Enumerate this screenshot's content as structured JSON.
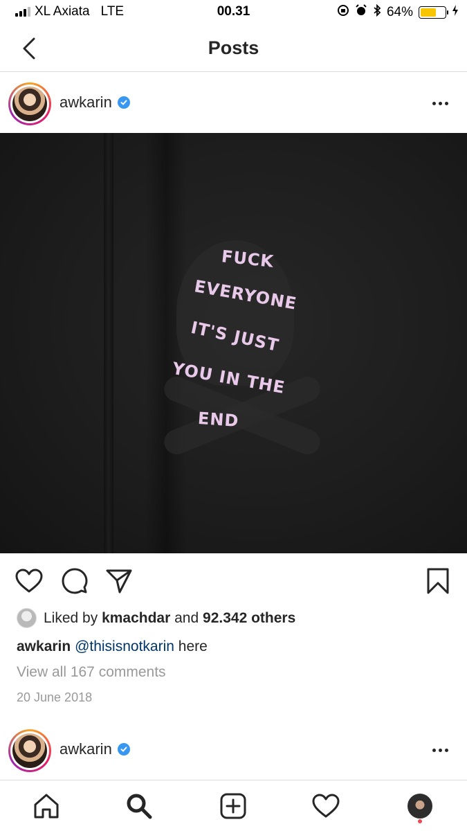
{
  "status_bar": {
    "carrier": "XL Axiata",
    "network": "LTE",
    "time": "00.31",
    "battery_percent": "64%",
    "battery_level": 0.64,
    "battery_color": "#f7c600"
  },
  "nav": {
    "title": "Posts",
    "back_icon": "chevron-left-icon"
  },
  "post": {
    "username": "awkarin",
    "verified": true,
    "more_icon": "more-horizontal-icon",
    "image_text": [
      "FUCK",
      "EVERYONE",
      "IT'S JUST",
      "YOU IN THE",
      "END"
    ],
    "actions": {
      "like_icon": "heart-icon",
      "comment_icon": "comment-icon",
      "share_icon": "send-icon",
      "save_icon": "bookmark-icon"
    },
    "likes": {
      "prefix": "Liked by",
      "liked_by_user": "kmachdar",
      "connector": "and",
      "others": "92.342 others"
    },
    "caption": {
      "user": "awkarin",
      "mention": "@thisisnotkarin",
      "text": "here"
    },
    "view_comments": "View all 167 comments",
    "date": "20 June 2018"
  },
  "next_post": {
    "username": "awkarin",
    "verified": true
  },
  "tabbar": {
    "items": [
      "home-icon",
      "search-icon",
      "new-post-icon",
      "activity-heart-icon",
      "profile-avatar"
    ],
    "notification_color": "#ed4956"
  },
  "colors": {
    "verified_blue": "#3897f0",
    "mention_blue": "#003569",
    "muted_text": "#999999"
  }
}
